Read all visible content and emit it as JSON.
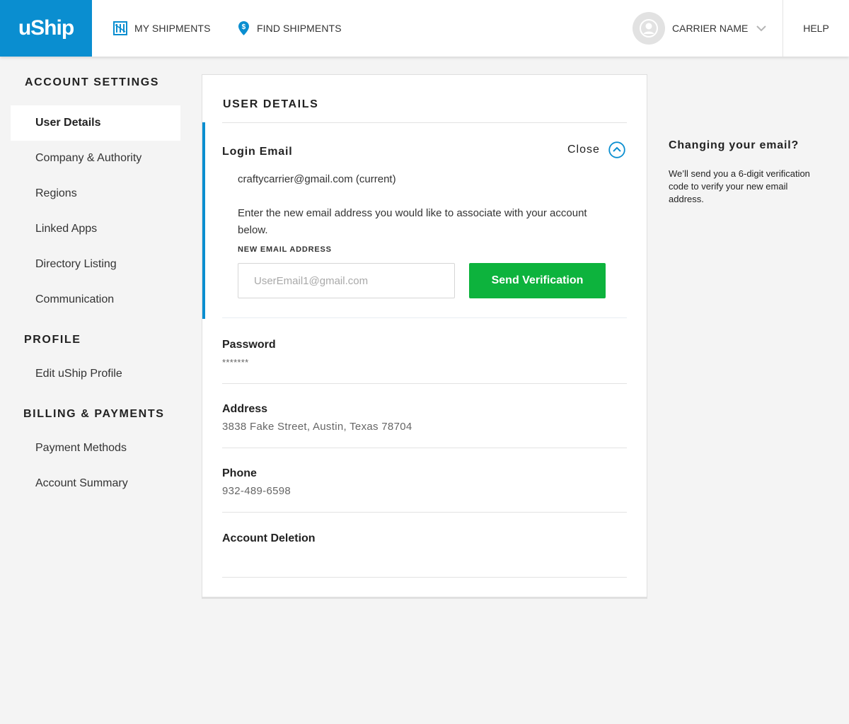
{
  "header": {
    "logo": "uShip",
    "nav": [
      {
        "label": "MY SHIPMENTS",
        "icon": "shipments-grid-icon"
      },
      {
        "label": "FIND SHIPMENTS",
        "icon": "map-pin-dollar-icon"
      }
    ],
    "user_name": "CARRIER NAME",
    "help_label": "HELP"
  },
  "sidebar": {
    "sections": [
      {
        "heading": "ACCOUNT SETTINGS",
        "items": [
          {
            "label": "User Details",
            "active": true
          },
          {
            "label": "Company & Authority"
          },
          {
            "label": "Regions"
          },
          {
            "label": "Linked Apps"
          },
          {
            "label": "Directory Listing"
          },
          {
            "label": "Communication"
          }
        ]
      },
      {
        "heading": "PROFILE",
        "items": [
          {
            "label": "Edit uShip Profile"
          }
        ]
      },
      {
        "heading": "BILLING & PAYMENTS",
        "items": [
          {
            "label": "Payment Methods"
          },
          {
            "label": "Account Summary"
          }
        ]
      }
    ]
  },
  "main": {
    "title": "USER DETAILS",
    "login_email": {
      "label": "Login Email",
      "close_label": "Close",
      "current": "craftycarrier@gmail.com (current)",
      "instructions": "Enter the new email address you would like to associate with your account below.",
      "field_label": "NEW EMAIL ADDRESS",
      "placeholder": "UserEmail1@gmail.com",
      "value": "",
      "button_label": "Send Verification"
    },
    "password": {
      "label": "Password",
      "value": "*******"
    },
    "address": {
      "label": "Address",
      "value": "3838 Fake Street, Austin, Texas 78704"
    },
    "phone": {
      "label": "Phone",
      "value": "932-489-6598"
    },
    "account_deletion": {
      "label": "Account Deletion"
    }
  },
  "help_panel": {
    "title": "Changing your email?",
    "text": "We’ll send you a 6-digit verification code to verify your new email address."
  },
  "colors": {
    "brand_blue": "#0a8ed0",
    "button_green": "#0db33d",
    "page_background": "#f4f4f4"
  }
}
